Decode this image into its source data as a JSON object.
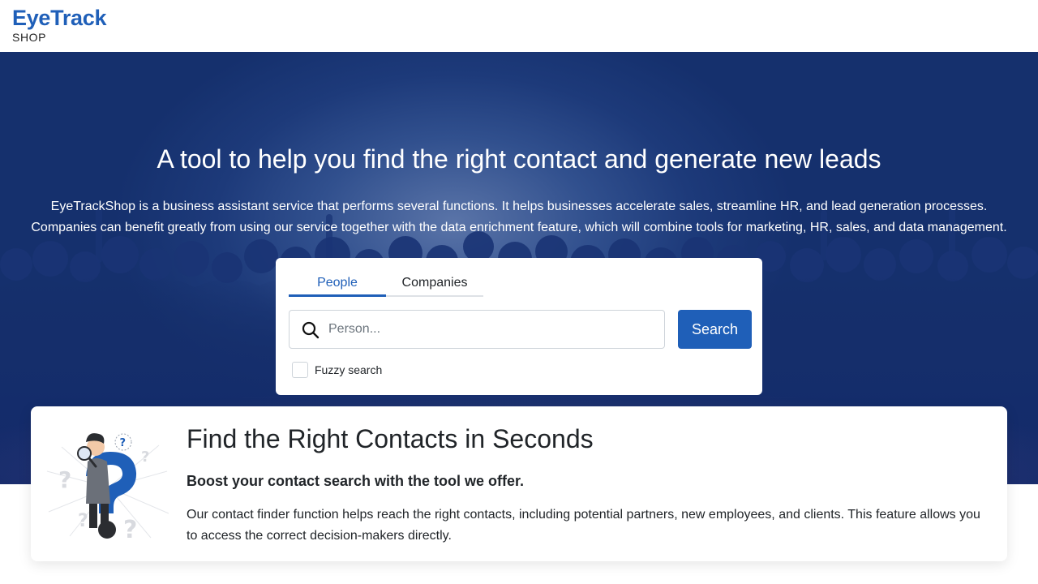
{
  "header": {
    "logo_main": "EyeTrack",
    "logo_sub": "SHOP"
  },
  "hero": {
    "title": "A tool to help you find the right contact and generate new leads",
    "description_line1": "EyeTrackShop is a business assistant service that performs several functions. It helps businesses accelerate sales, streamline HR, and lead generation processes.",
    "description_line2": "Companies can benefit greatly from using our service together with the data enrichment feature, which will combine tools for marketing, HR, sales, and data management."
  },
  "search": {
    "tabs": [
      {
        "label": "People",
        "active": true
      },
      {
        "label": "Companies",
        "active": false
      }
    ],
    "placeholder": "Person...",
    "value": "",
    "button_label": "Search",
    "fuzzy_label": "Fuzzy search",
    "fuzzy_checked": false,
    "icon": "search-icon"
  },
  "feature": {
    "title": "Find the Right Contacts in Seconds",
    "subtitle": "Boost your contact search with the tool we offer.",
    "body": "Our contact finder function helps reach the right contacts, including potential partners, new employees, and clients. This feature allows you to access the correct decision-makers directly.",
    "illustration": "person-with-question-mark-illustration"
  },
  "colors": {
    "brand": "#1f5fb8",
    "hero_bg": "#1d3a7a",
    "text": "#212529"
  }
}
